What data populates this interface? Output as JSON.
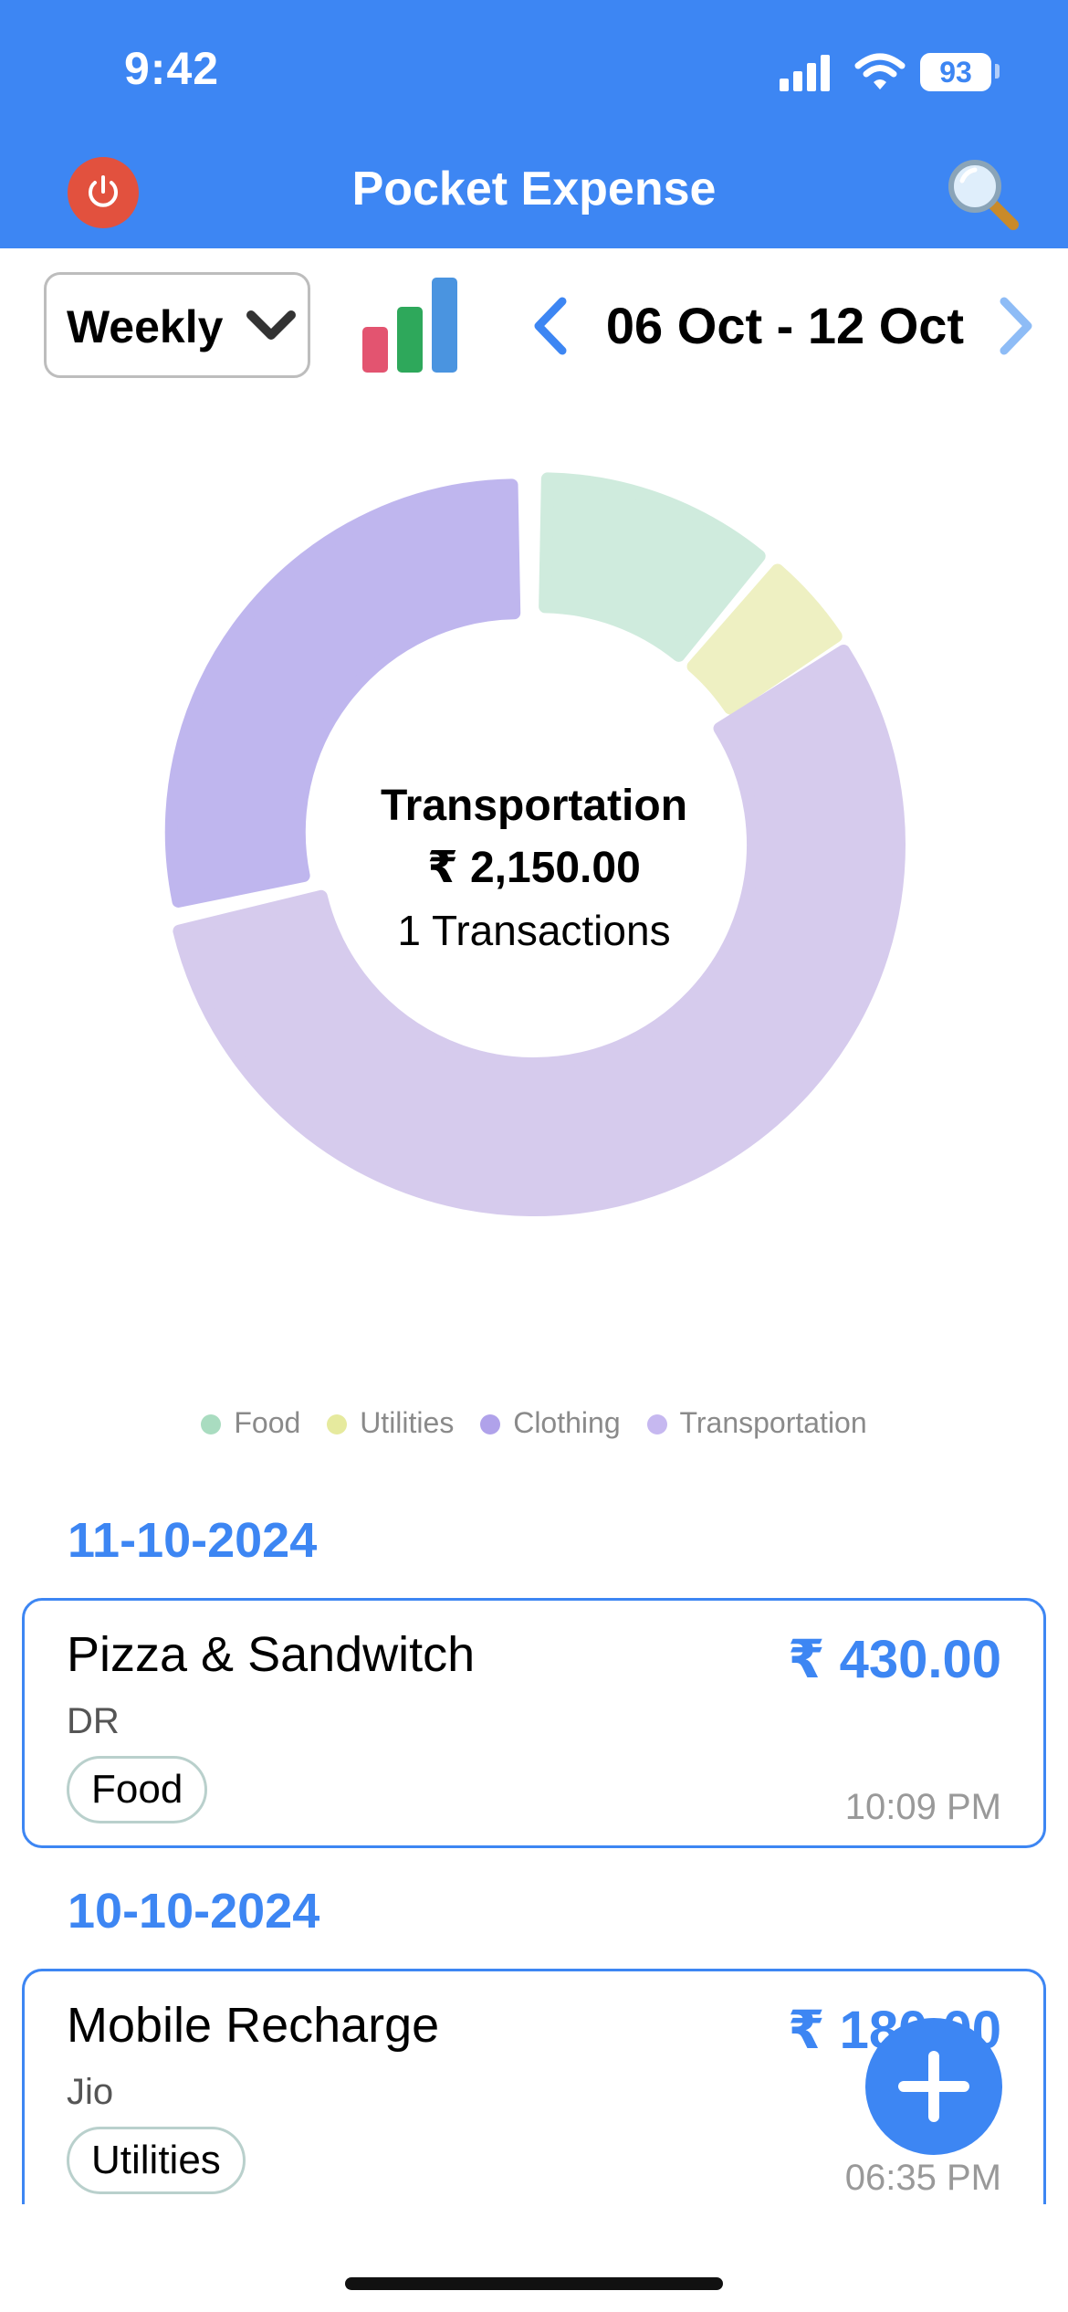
{
  "status_bar": {
    "time": "9:42",
    "battery": "93"
  },
  "header": {
    "title": "Pocket Expense",
    "power_icon": "power-icon",
    "search_icon": "magnifier-icon"
  },
  "toolbar": {
    "period": "Weekly",
    "date_range": "06 Oct - 12 Oct",
    "chart_icon": "bar-chart-icon"
  },
  "chart_data": {
    "type": "pie",
    "style": "donut",
    "series": [
      {
        "name": "Food",
        "value": 430,
        "color": "#cfebdd"
      },
      {
        "name": "Utilities",
        "value": 180,
        "color": "#eef0c2"
      },
      {
        "name": "Transportation",
        "value": 2150,
        "color": "#d6cbed"
      },
      {
        "name": "Clothing",
        "value": 1100,
        "color": "#bfb6ee"
      }
    ],
    "selected": "Transportation",
    "legend_position": "bottom"
  },
  "center": {
    "category": "Transportation",
    "amount": "₹ 2,150.00",
    "count": "1 Transactions"
  },
  "legend": [
    {
      "label": "Food",
      "color": "#a9dcc0"
    },
    {
      "label": "Utilities",
      "color": "#e6ea9e"
    },
    {
      "label": "Clothing",
      "color": "#b0a2ea"
    },
    {
      "label": "Transportation",
      "color": "#c6b8f0"
    }
  ],
  "groups": [
    {
      "date": "11-10-2024",
      "transactions": [
        {
          "title": "Pizza & Sandwitch",
          "payee": "DR",
          "category": "Food",
          "amount": "₹ 430.00",
          "time": "10:09 PM"
        }
      ]
    },
    {
      "date": "10-10-2024",
      "transactions": [
        {
          "title": "Mobile Recharge",
          "payee": "Jio",
          "category": "Utilities",
          "amount": "₹ 180.00",
          "time": "06:35 PM"
        }
      ]
    }
  ],
  "fab": {
    "icon": "plus-icon"
  }
}
